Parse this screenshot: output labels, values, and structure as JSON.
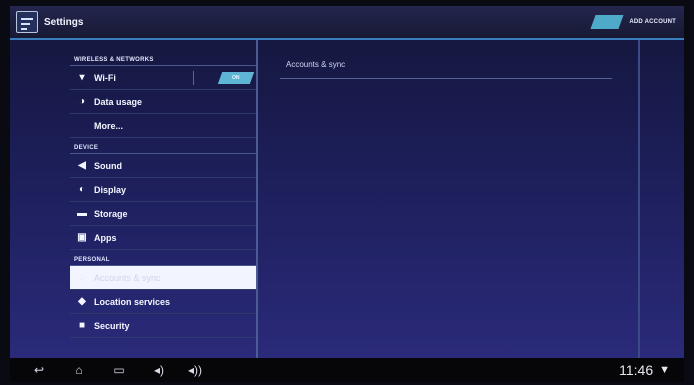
{
  "actionbar": {
    "title": "Settings",
    "add_account": "ADD ACCOUNT"
  },
  "sections": {
    "wireless": "WIRELESS & NETWORKS",
    "device": "DEVICE",
    "personal": "PERSONAL"
  },
  "items": {
    "wifi": "Wi-Fi",
    "wifi_toggle": "ON",
    "data_usage": "Data usage",
    "more": "More...",
    "sound": "Sound",
    "display": "Display",
    "storage": "Storage",
    "apps": "Apps",
    "accounts": "Accounts & sync",
    "location": "Location services",
    "security": "Security"
  },
  "right": {
    "title": "Accounts & sync"
  },
  "status": {
    "clock": "11:46"
  },
  "icons": {
    "app": "settings-icon",
    "wifi": "wifi-icon",
    "data": "data-usage-icon",
    "sound": "sound-icon",
    "display": "display-icon",
    "storage": "storage-icon",
    "apps": "apps-icon",
    "location": "location-icon",
    "security": "lock-icon",
    "back": "back-icon",
    "home": "home-icon",
    "recent": "recent-apps-icon",
    "vol_down": "volume-down-icon",
    "vol_up": "volume-up-icon",
    "status_wifi": "wifi-status-icon"
  },
  "colors": {
    "accent": "#3a7ec0",
    "toggle": "#5fb5d5",
    "background": "#1b1d55"
  }
}
